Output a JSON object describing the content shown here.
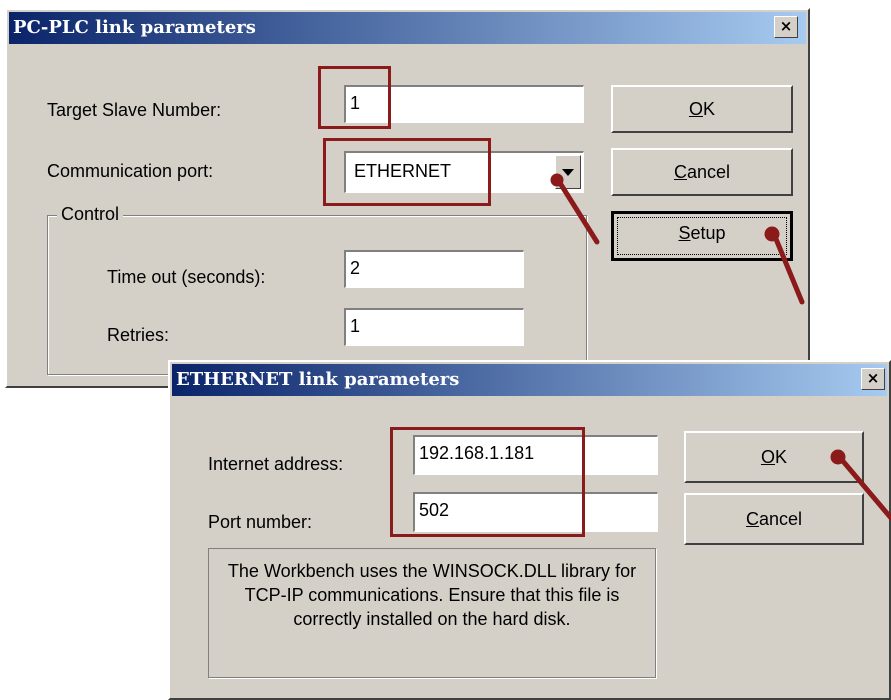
{
  "plc_dialog": {
    "title": "PC-PLC link parameters",
    "close_glyph": "×",
    "target_slave_label": "Target Slave Number:",
    "target_slave_value": "1",
    "comm_port_label": "Communication port:",
    "comm_port_value": "ETHERNET",
    "control_group_label": "Control",
    "timeout_label": "Time out (seconds):",
    "timeout_value": "2",
    "retries_label": "Retries:",
    "retries_value": "1",
    "ok_button": {
      "mnemonic": "O",
      "rest": "K"
    },
    "cancel_button": {
      "mnemonic": "C",
      "rest": "ancel"
    },
    "setup_button": {
      "mnemonic": "S",
      "rest": "etup"
    }
  },
  "ethernet_dialog": {
    "title": "ETHERNET link parameters",
    "close_glyph": "×",
    "ip_label": "Internet address:",
    "ip_value": "192.168.1.181",
    "port_label": "Port number:",
    "port_value": "502",
    "ok_button": {
      "mnemonic": "O",
      "rest": "K"
    },
    "cancel_button": {
      "mnemonic": "C",
      "rest": "ancel"
    },
    "info_text": "The Workbench uses the WINSOCK.DLL library for TCP-IP communications. Ensure that this file is correctly installed on the hard disk."
  },
  "colors": {
    "annotation": "#8b1a1a",
    "title_gradient_start": "#0a246a",
    "title_gradient_end": "#a6caf0",
    "dialog_face": "#d4d0c8"
  }
}
